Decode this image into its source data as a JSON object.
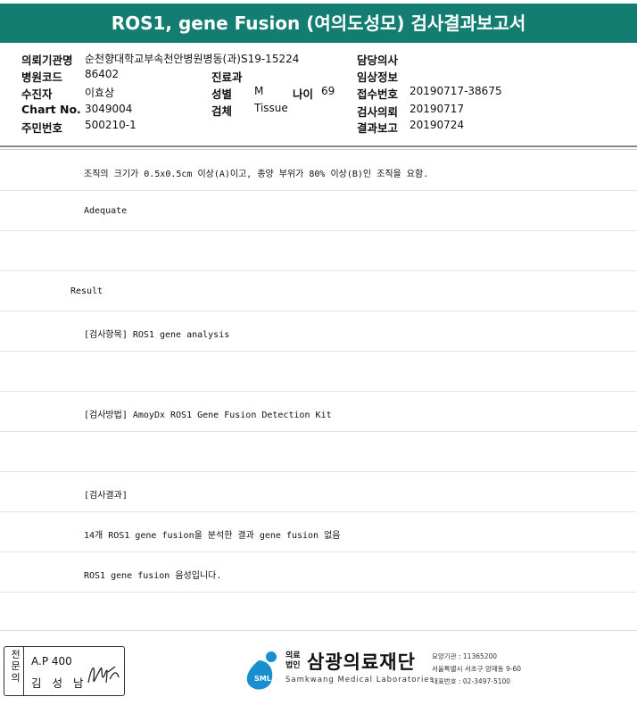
{
  "title": "ROS1, gene Fusion (여의도성모) 검사결과보고서",
  "header": {
    "hospital_label": "의뢰기관명",
    "hospital_value": "순천향대학교부속천안병원병동(과)",
    "hospital_code_label": "병원코드",
    "hospital_code_value": "86402",
    "patient_label": "수진자",
    "patient_value": "이효상",
    "chart_label": "Chart No.",
    "chart_value": "3049004",
    "rrn_label": "주민번호",
    "rrn_value": "500210-1",
    "specimen_no": "S19-15224",
    "dept_label": "진료과",
    "sex_label": "성별",
    "sex_value": "M",
    "age_label": "나이",
    "age_value": "69",
    "specimen_label": "검체",
    "specimen_value": "Tissue",
    "doctor_label": "담당의사",
    "clinical_label": "임상정보",
    "receipt_label": "접수번호",
    "receipt_value": "20190717-38675",
    "request_label": "검사의뢰",
    "request_value": "20190717",
    "report_label": "결과보고",
    "report_value": "20190724"
  },
  "rows": [
    "조직의 크기가 0.5x0.5cm 이상(A)이고, 종양 부위가 80% 이상(B)인 조직을 요함.",
    "Adequate",
    "",
    "Result",
    "[검사항목] ROS1 gene analysis",
    "",
    "[검사방법] AmoyDx ROS1 Gene Fusion Detection Kit",
    "",
    "[검사결과]",
    "14개 ROS1 gene fusion을 분석한 결과 gene fusion 없음",
    "ROS1 gene fusion 음성입니다."
  ],
  "footer": {
    "role_vertical": "전문의",
    "code": "A.P 400",
    "name": "김 성 남",
    "org_type": "의료\n법인",
    "org_name": "삼광의료재단",
    "org_en": "Samkwang Medical Laboratories",
    "logo_text": "SML",
    "info_1": "요양기관 : 11365200",
    "info_2": "서울특별시 서초구 양재동 9-60",
    "info_3": "대표번호 : 02-3497-5100"
  },
  "colors": {
    "title_bg": "#127d70",
    "logo_blue": "#1a8fd0"
  }
}
